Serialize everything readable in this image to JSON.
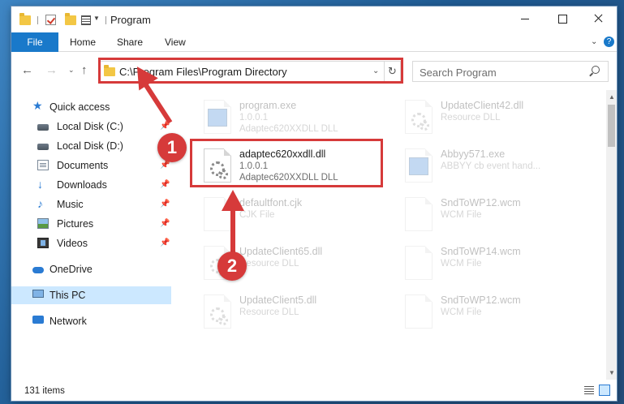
{
  "window": {
    "title": "Program"
  },
  "ribbon": {
    "tabs": [
      "File",
      "Home",
      "Share",
      "View"
    ]
  },
  "address": {
    "path": "C:\\Program Files\\Program Directory"
  },
  "search": {
    "placeholder": "Search Program"
  },
  "nav": {
    "items": [
      {
        "label": "Quick access"
      },
      {
        "label": "Local Disk (C:)"
      },
      {
        "label": "Local Disk (D:)"
      },
      {
        "label": "Documents"
      },
      {
        "label": "Downloads"
      },
      {
        "label": "Music"
      },
      {
        "label": "Pictures"
      },
      {
        "label": "Videos"
      },
      {
        "label": "OneDrive"
      },
      {
        "label": "This PC"
      },
      {
        "label": "Network"
      }
    ]
  },
  "files": [
    {
      "name": "program.exe",
      "line2": "1.0.0.1",
      "line3": "Adaptec620XXDLL DLL"
    },
    {
      "name": "UpdateClient42.dll",
      "line2": "Resource DLL",
      "line3": ""
    },
    {
      "name": "adaptec620xxdll.dll",
      "line2": "1.0.0.1",
      "line3": "Adaptec620XXDLL DLL"
    },
    {
      "name": "Abbyy571.exe",
      "line2": "ABBYY cb event hand...",
      "line3": ""
    },
    {
      "name": "defaultfont.cjk",
      "line2": "CJK File",
      "line3": ""
    },
    {
      "name": "SndToWP12.wcm",
      "line2": "WCM File",
      "line3": ""
    },
    {
      "name": "UpdateClient65.dll",
      "line2": "Resource DLL",
      "line3": ""
    },
    {
      "name": "SndToWP14.wcm",
      "line2": "WCM File",
      "line3": ""
    },
    {
      "name": "UpdateClient5.dll",
      "line2": "Resource DLL",
      "line3": ""
    },
    {
      "name": "SndToWP12.wcm",
      "line2": "WCM File",
      "line3": ""
    }
  ],
  "callouts": [
    "1",
    "2"
  ],
  "status": {
    "count": "131 items"
  },
  "colors": {
    "accent": "#1979ca",
    "highlight": "#d63a3a",
    "selection": "#cce8ff"
  }
}
